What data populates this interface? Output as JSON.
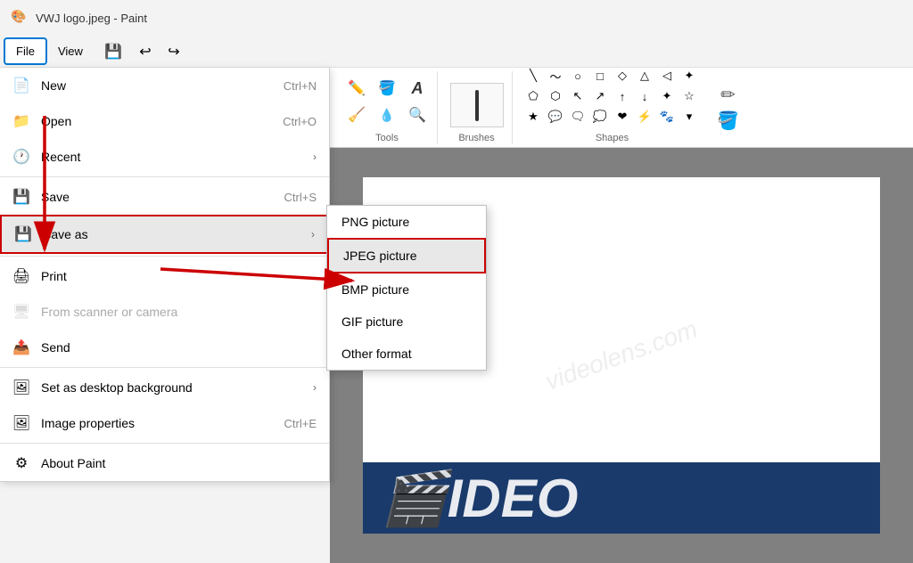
{
  "titlebar": {
    "app_icon": "🎨",
    "title": "VWJ logo.jpeg - Paint"
  },
  "menubar": {
    "items": [
      {
        "id": "file",
        "label": "File",
        "active": true
      },
      {
        "id": "view",
        "label": "View",
        "active": false
      }
    ],
    "save_icon": "💾",
    "undo_icon": "↩",
    "redo_icon": "↪"
  },
  "ribbon": {
    "tools_label": "Tools",
    "brushes_label": "Brushes",
    "shapes_label": "Shapes",
    "tools_icons": [
      "✏️",
      "🖌️",
      "A",
      "🧪",
      "💧",
      "🔍"
    ],
    "shapes": [
      "\\",
      "〜",
      "○",
      "□",
      "◇",
      "△",
      "▷",
      "✦",
      "◇",
      "⬡",
      "▷",
      "↖",
      "↗",
      "↑",
      "↓",
      "✦",
      "☆",
      "★",
      "💬",
      "💬",
      "🗨",
      "💟",
      "❤",
      "🐾"
    ]
  },
  "file_menu": {
    "items": [
      {
        "id": "new",
        "icon": "📄",
        "label": "New",
        "shortcut": "Ctrl+N",
        "arrow": false,
        "disabled": false,
        "highlighted": false
      },
      {
        "id": "open",
        "icon": "📁",
        "label": "Open",
        "shortcut": "Ctrl+O",
        "arrow": false,
        "disabled": false,
        "highlighted": false
      },
      {
        "id": "recent",
        "icon": "🕐",
        "label": "Recent",
        "shortcut": "",
        "arrow": true,
        "disabled": false,
        "highlighted": false
      },
      {
        "id": "save",
        "icon": "💾",
        "label": "Save",
        "shortcut": "Ctrl+S",
        "arrow": false,
        "disabled": false,
        "highlighted": false
      },
      {
        "id": "save-as",
        "icon": "💾",
        "label": "Save as",
        "shortcut": "",
        "arrow": true,
        "disabled": false,
        "highlighted": true
      },
      {
        "id": "print",
        "icon": "🖨️",
        "label": "Print",
        "shortcut": "",
        "arrow": false,
        "disabled": false,
        "highlighted": false
      },
      {
        "id": "scanner",
        "icon": "🖥️",
        "label": "From scanner or camera",
        "shortcut": "",
        "arrow": false,
        "disabled": true,
        "highlighted": false
      },
      {
        "id": "send",
        "icon": "📤",
        "label": "Send",
        "shortcut": "",
        "arrow": false,
        "disabled": false,
        "highlighted": false
      },
      {
        "id": "desktop",
        "icon": "🖼️",
        "label": "Set as desktop background",
        "shortcut": "",
        "arrow": true,
        "disabled": false,
        "highlighted": false
      },
      {
        "id": "properties",
        "icon": "🖼️",
        "label": "Image properties",
        "shortcut": "Ctrl+E",
        "arrow": false,
        "disabled": false,
        "highlighted": false
      },
      {
        "id": "about",
        "icon": "⚙️",
        "label": "About Paint",
        "shortcut": "",
        "arrow": false,
        "disabled": false,
        "highlighted": false
      }
    ]
  },
  "submenu": {
    "items": [
      {
        "id": "png",
        "label": "PNG picture",
        "highlighted": false
      },
      {
        "id": "jpeg",
        "label": "JPEG picture",
        "highlighted": true
      },
      {
        "id": "bmp",
        "label": "BMP picture",
        "highlighted": false
      },
      {
        "id": "gif",
        "label": "GIF picture",
        "highlighted": false
      },
      {
        "id": "other",
        "label": "Other format",
        "highlighted": false
      }
    ]
  },
  "canvas": {
    "image_text": "IDEO",
    "watermark": "videolens.com"
  },
  "colors": {
    "accent": "#0078d4",
    "highlight_border": "#cc0000",
    "arrow_color": "#cc0000"
  }
}
